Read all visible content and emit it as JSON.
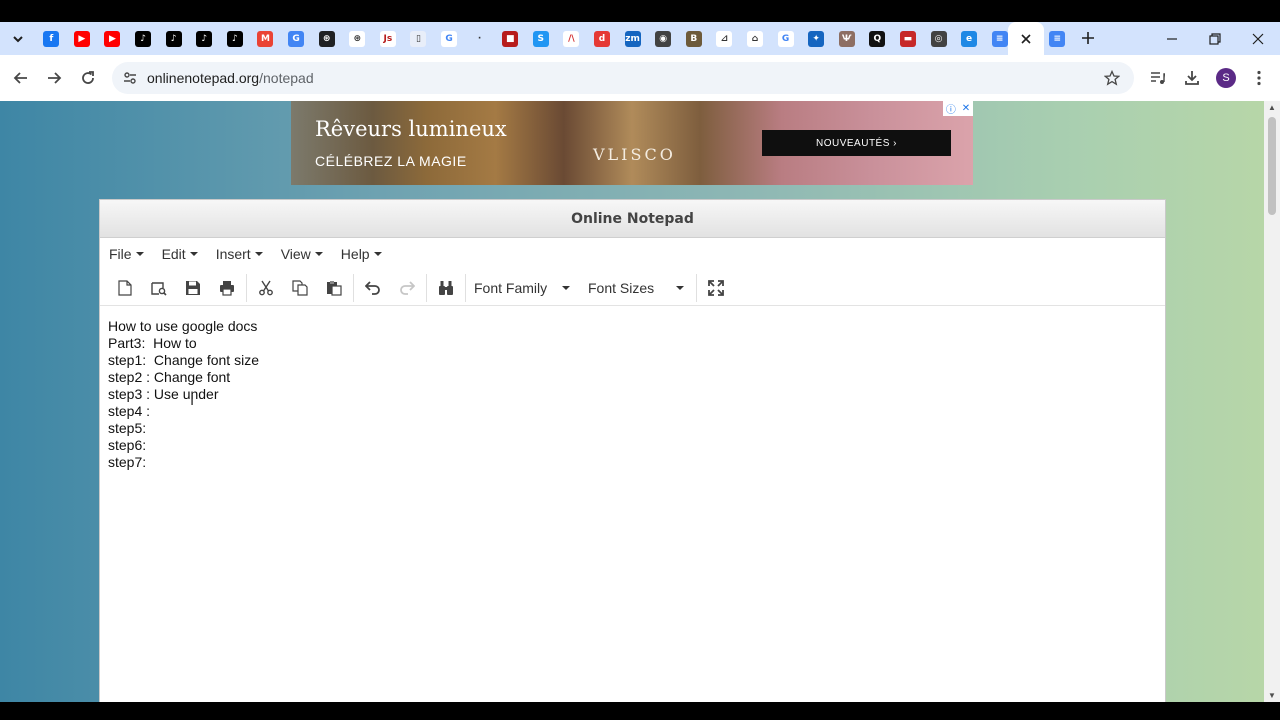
{
  "browser": {
    "tabs": [
      {
        "icon": "facebook-icon",
        "color": "#1877f2",
        "glyph": "f"
      },
      {
        "icon": "youtube-icon",
        "color": "#ff0000",
        "glyph": "▶"
      },
      {
        "icon": "youtube-icon",
        "color": "#ff0000",
        "glyph": "▶"
      },
      {
        "icon": "tiktok-icon",
        "color": "#000000",
        "glyph": "♪"
      },
      {
        "icon": "tiktok-icon",
        "color": "#000000",
        "glyph": "♪"
      },
      {
        "icon": "tiktok-icon",
        "color": "#000000",
        "glyph": "♪"
      },
      {
        "icon": "tiktok-icon",
        "color": "#000000",
        "glyph": "♪"
      },
      {
        "icon": "gmail-icon",
        "color": "#ea4335",
        "glyph": "M"
      },
      {
        "icon": "google-translate-icon",
        "color": "#4285f4",
        "glyph": "G"
      },
      {
        "icon": "chatgpt-icon",
        "color": "#202123",
        "glyph": "⊛"
      },
      {
        "icon": "chatgpt-icon",
        "color": "#ffffff",
        "glyph": "⊛"
      },
      {
        "icon": "js-icon",
        "color": "#ffffff",
        "glyph": "Js"
      },
      {
        "icon": "document-icon",
        "color": "#e8eef9",
        "glyph": "▯"
      },
      {
        "icon": "google-icon",
        "color": "#ffffff",
        "glyph": "G"
      },
      {
        "icon": "generic-page-icon",
        "color": "#d3e3fd",
        "glyph": "·"
      },
      {
        "icon": "red-square-icon",
        "color": "#b71c1c",
        "glyph": "■"
      },
      {
        "icon": "s-icon",
        "color": "#2196f3",
        "glyph": "S"
      },
      {
        "icon": "triangle-icon",
        "color": "#ffffff",
        "glyph": "/\\"
      },
      {
        "icon": "d-icon",
        "color": "#e53935",
        "glyph": "d"
      },
      {
        "icon": "zm-icon",
        "color": "#1565c0",
        "glyph": "zm"
      },
      {
        "icon": "globe-icon",
        "color": "#424242",
        "glyph": "◉"
      },
      {
        "icon": "b-icon",
        "color": "#6d5a3a",
        "glyph": "B"
      },
      {
        "icon": "chart-icon",
        "color": "#ffffff",
        "glyph": "⊿"
      },
      {
        "icon": "gift-icon",
        "color": "#ffffff",
        "glyph": "⌂"
      },
      {
        "icon": "google-icon",
        "color": "#ffffff",
        "glyph": "G"
      },
      {
        "icon": "africa-map-icon",
        "color": "#1565c0",
        "glyph": "✦"
      },
      {
        "icon": "eagle-icon",
        "color": "#8d6e63",
        "glyph": "Ѱ"
      },
      {
        "icon": "q-icon",
        "color": "#111111",
        "glyph": "Q"
      },
      {
        "icon": "chat-icon",
        "color": "#c62828",
        "glyph": "▬"
      },
      {
        "icon": "chrome-icon",
        "color": "#424242",
        "glyph": "◎"
      },
      {
        "icon": "edge-icon",
        "color": "#1e88e5",
        "glyph": "e"
      },
      {
        "icon": "docs-icon",
        "color": "#4285f4",
        "glyph": "≡"
      }
    ],
    "active_tab_icon": "close-icon",
    "after_tab_icon": "docs-icon",
    "url_host": "onlinenotepad.org",
    "url_path": "/notepad"
  },
  "ad": {
    "title": "Rêveurs lumineux",
    "subtitle": "CÉLÉBREZ LA MAGIE",
    "brand": "VLISCO",
    "cta": "NOUVEAUTÉS ›"
  },
  "notepad": {
    "title": "Online Notepad",
    "menu": [
      "File",
      "Edit",
      "Insert",
      "View",
      "Help"
    ],
    "font_family_label": "Font Family",
    "font_sizes_label": "Font Sizes",
    "lines": [
      "How to use google docs",
      "Part3:  How to",
      "step1:  Change font size",
      "step2 : Change font",
      "step3 : Use under",
      "step4 :",
      "step5:",
      "step6:",
      "step7:"
    ]
  },
  "profile_initial": "S"
}
